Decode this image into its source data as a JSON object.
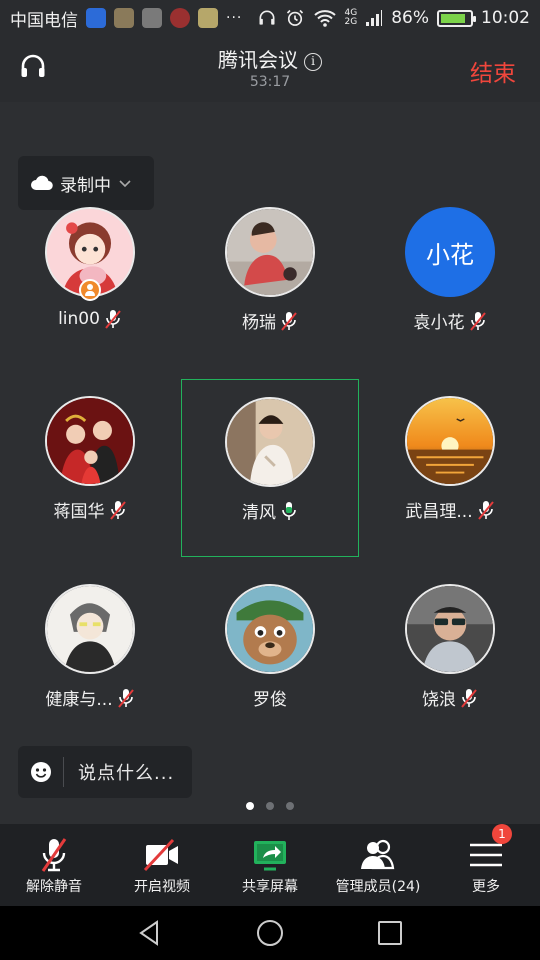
{
  "status_bar": {
    "carrier": "中国电信",
    "net_top": "4G",
    "net_bottom": "2G",
    "battery": "86%",
    "battery_level": 0.86,
    "time": "10:02",
    "more": "···"
  },
  "header": {
    "title": "腾讯会议",
    "info_glyph": "i",
    "duration": "53:17",
    "end_label": "结束"
  },
  "recording": {
    "label": "录制中"
  },
  "participants": [
    {
      "name": "lin00",
      "mic": "muted",
      "avatar": "cartoon-girl",
      "host": true
    },
    {
      "name": "杨瑞",
      "mic": "muted",
      "avatar": "baby-photo"
    },
    {
      "name": "袁小花",
      "mic": "muted",
      "avatar": "text",
      "avatar_text": "小花"
    },
    {
      "name": "蒋国华",
      "mic": "muted",
      "avatar": "family-photo"
    },
    {
      "name": "清风",
      "mic": "active",
      "avatar": "man-photo",
      "speaking": true
    },
    {
      "name": "武昌理...",
      "mic": "muted",
      "avatar": "sunset-photo"
    },
    {
      "name": "健康与...",
      "mic": "muted",
      "avatar": "sketch-man"
    },
    {
      "name": "罗俊",
      "mic": "none",
      "avatar": "cartoon-animal"
    },
    {
      "name": "饶浪",
      "mic": "muted",
      "avatar": "sunglasses-man"
    }
  ],
  "chat": {
    "placeholder": "说点什么..."
  },
  "pager": {
    "pages": 3,
    "current": 1
  },
  "toolbar": {
    "items": [
      {
        "label": "解除静音",
        "icon": "mic-muted-icon"
      },
      {
        "label": "开启视频",
        "icon": "video-off-icon"
      },
      {
        "label": "共享屏幕",
        "icon": "share-screen-icon"
      },
      {
        "label": "管理成员(24)",
        "icon": "members-icon"
      },
      {
        "label": "更多",
        "icon": "menu-icon",
        "badge": "1"
      }
    ]
  },
  "colors": {
    "accent_green": "#22b25c",
    "end_red": "#f0463c",
    "avatar_blue": "#1e6fe6"
  }
}
